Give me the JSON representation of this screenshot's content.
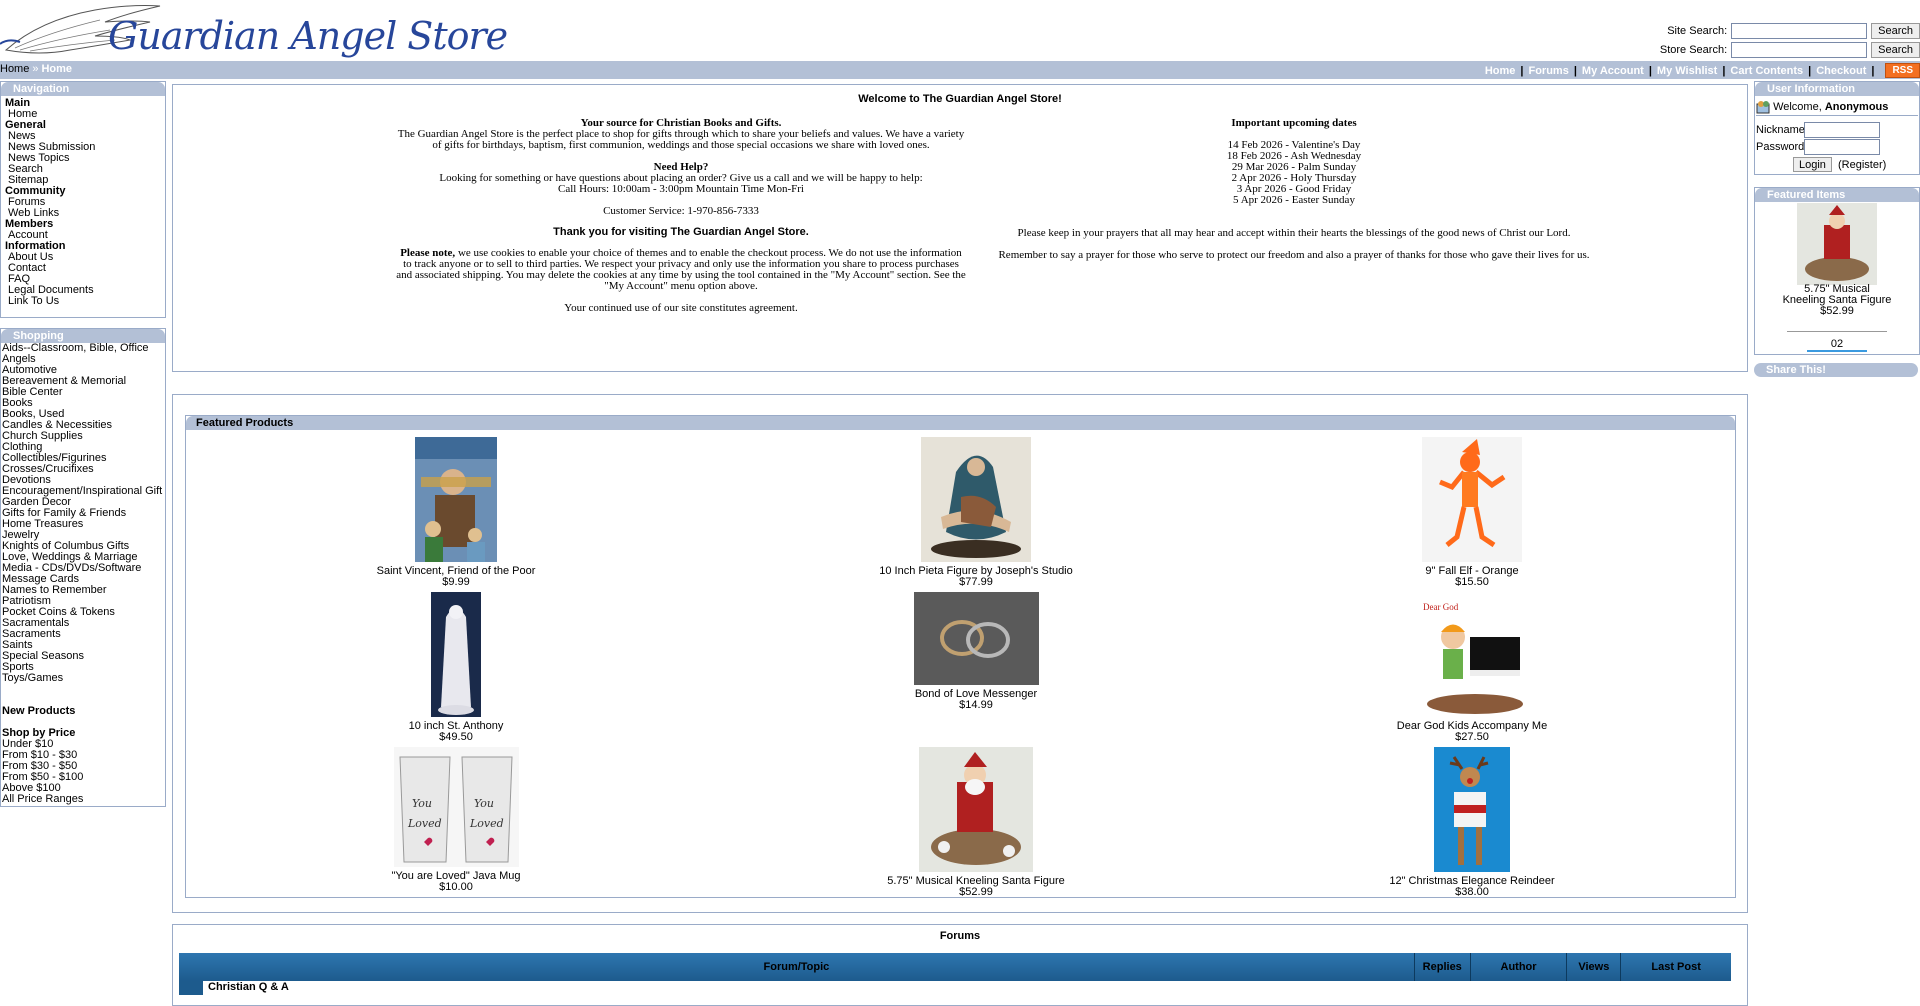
{
  "header": {
    "logo_text": "Guardian Angel Store",
    "site_search_label": "Site Search:",
    "store_search_label": "Store Search:",
    "search_button": "Search"
  },
  "breadcrumb": {
    "home": "Home",
    "separator": "»",
    "current": "Home"
  },
  "toplinks": [
    "Home",
    "Forums",
    "My Account",
    "My Wishlist",
    "Cart Contents",
    "Checkout"
  ],
  "rss": "RSS",
  "navigation": {
    "title": "Navigation",
    "groups": [
      {
        "category": "Main",
        "items": [
          "Home"
        ]
      },
      {
        "category": "General",
        "items": [
          "News",
          "News Submission",
          "News Topics",
          "Search",
          "Sitemap"
        ]
      },
      {
        "category": "Community",
        "items": [
          "Forums",
          "Web Links"
        ]
      },
      {
        "category": "Members",
        "items": [
          "Account"
        ]
      },
      {
        "category": "Information",
        "items": [
          "About Us",
          "Contact",
          "FAQ",
          "Legal Documents",
          "Link To Us"
        ]
      }
    ]
  },
  "shopping": {
    "title": "Shopping",
    "categories": [
      "Aids--Classroom, Bible, Office",
      "Angels",
      "Automotive",
      "Bereavement & Memorial",
      "Bible Center",
      "Books",
      "Books, Used",
      "Candles & Necessities",
      "Church Supplies",
      "Clothing",
      "Collectibles/Figurines",
      "Crosses/Crucifixes",
      "Devotions",
      "Encouragement/Inspirational Gift",
      "Garden Decor",
      "Gifts for Family & Friends",
      "Home Treasures",
      "Jewelry",
      "Knights of Columbus Gifts",
      "Love, Weddings & Marriage",
      "Media - CDs/DVDs/Software",
      "Message Cards",
      "Names to Remember",
      "Patriotism",
      "Pocket Coins & Tokens",
      "Sacramentals",
      "Sacraments",
      "Saints",
      "Special Seasons",
      "Sports",
      "Toys/Games"
    ],
    "new_products": "New Products",
    "shop_by_price": "Shop by Price",
    "price_ranges": [
      "Under $10",
      "From $10 - $30",
      "From $30 - $50",
      "From $50 - $100",
      "Above $100",
      "All Price Ranges"
    ]
  },
  "welcome": {
    "title": "Welcome to The Guardian Angel Store!",
    "source_heading": "Your source for Christian Books and Gifts.",
    "source_text": "The Guardian Angel Store is the perfect place to shop for gifts through which to share your beliefs and values. We have a variety of gifts for birthdays, baptism, first communion, weddings and those special occasions we share with loved ones.",
    "help_heading": "Need Help?",
    "help_text1": "Looking for something or have questions about placing an order? Give us a call and we will be happy to help:",
    "help_text2": "Call Hours: 10:00am - 3:00pm Mountain Time Mon-Fri",
    "customer_service": "Customer Service: 1-970-856-7333",
    "thanks": "Thank you for visiting The Guardian Angel Store.",
    "note_label": "Please note,",
    "note_text": "we use cookies to enable your choice of themes and to enable the checkout process. We do not use the information to track anyone or to sell to third parties. We respect your privacy and only use the information you share to process purchases and associated shipping. You may delete the cookies at any time by using the tool contained in the \"My Account\" section. See the \"My Account\" menu option above.",
    "agreement": "Your continued use of our site constitutes agreement.",
    "dates_heading": "Important upcoming dates",
    "dates": [
      "14 Feb 2026 - Valentine's Day",
      "18 Feb 2026 - Ash Wednesday",
      "29 Mar 2026 - Palm Sunday",
      "2 Apr 2026 - Holy Thursday",
      "3 Apr 2026 - Good Friday",
      "5 Apr 2026 - Easter Sunday"
    ],
    "prayer1": "Please keep in your prayers that all may hear and accept within their hearts the blessings of the good news of Christ our Lord.",
    "prayer2": "Remember to say a prayer for those who serve to protect our freedom and also a prayer of thanks for those who gave their lives for us."
  },
  "featured_products": {
    "title": "Featured Products",
    "items": [
      {
        "name": "Saint Vincent, Friend of the Poor",
        "price": "$9.99"
      },
      {
        "name": "10 Inch Pieta Figure by Joseph's Studio",
        "price": "$77.99"
      },
      {
        "name": "9\" Fall Elf - Orange",
        "price": "$15.50"
      },
      {
        "name": "10 inch St. Anthony",
        "price": "$49.50"
      },
      {
        "name": "Bond of Love Messenger",
        "price": "$14.99"
      },
      {
        "name": "Dear God Kids Accompany Me",
        "price": "$27.50"
      },
      {
        "name": "\"You are Loved\" Java Mug",
        "price": "$10.00"
      },
      {
        "name": "5.75\" Musical Kneeling Santa Figure",
        "price": "$52.99"
      },
      {
        "name": "12\" Christmas Elegance Reindeer",
        "price": "$38.00"
      }
    ]
  },
  "forums": {
    "title": "Forums",
    "columns": [
      "Forum/Topic",
      "Replies",
      "Author",
      "Views",
      "Last Post"
    ],
    "first_row": "Christian Q & A"
  },
  "user_info": {
    "title": "User Information",
    "welcome": "Welcome,",
    "user": "Anonymous",
    "nickname_label": "Nickname",
    "password_label": "Password",
    "login_button": "Login",
    "register": "(Register)"
  },
  "featured_items": {
    "title": "Featured Items",
    "name_line1": "5.75\" Musical",
    "name_line2": "Kneeling Santa Figure",
    "price": "$52.99",
    "pager": "02"
  },
  "share": {
    "title": "Share This!"
  },
  "colors": {
    "header_bar": "#b3c0d6",
    "border": "#9aabc8",
    "logo_blue": "#27469a",
    "rss_orange": "#f36f21",
    "forum_head": "#1d5b8d"
  }
}
